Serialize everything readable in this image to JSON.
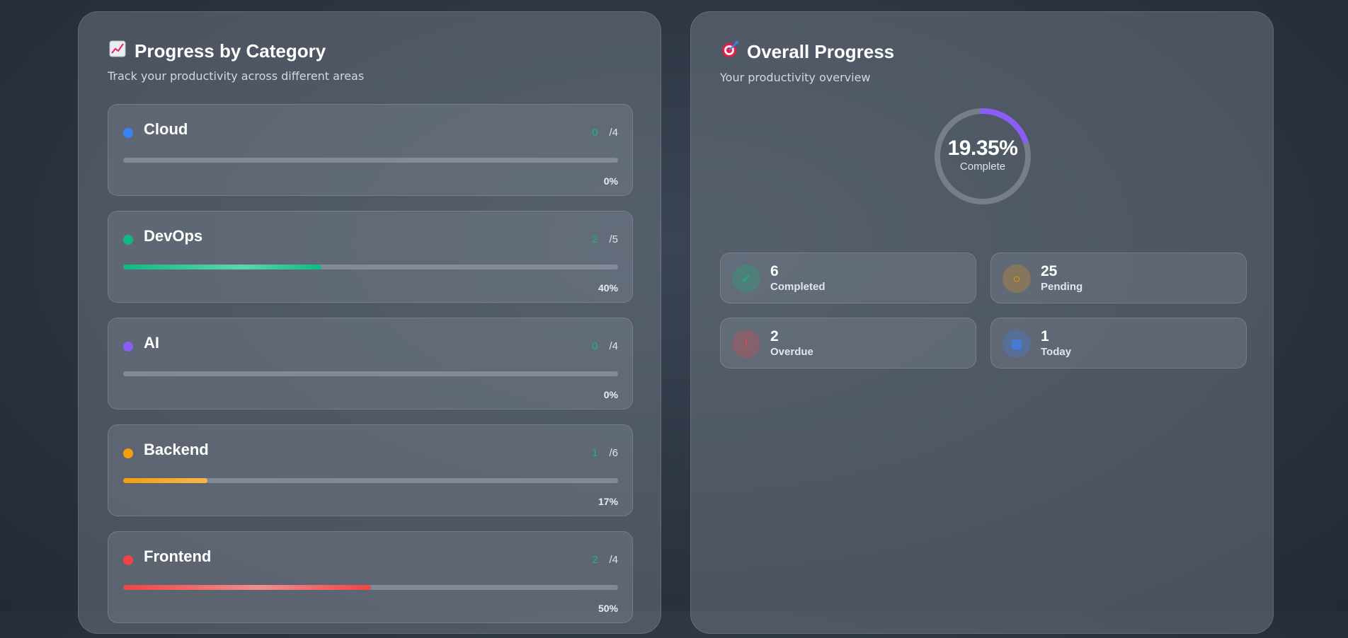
{
  "categories_panel": {
    "icon": "chart-increasing-icon",
    "title": "Progress by Category",
    "subtitle": "Track your productivity across different areas",
    "items": [
      {
        "name": "Cloud",
        "done": "0",
        "total": "/4",
        "percent_label": "0%",
        "progress": 0,
        "color": "#3b82f6",
        "fill": "#3b82f6"
      },
      {
        "name": "DevOps",
        "done": "2",
        "total": "/5",
        "percent_label": "40%",
        "progress": 0.4,
        "color": "#10b981",
        "fill": "linear-gradient(90deg,#10b981,#5ed6ad 60%,#10b981)"
      },
      {
        "name": "AI",
        "done": "0",
        "total": "/4",
        "percent_label": "0%",
        "progress": 0,
        "color": "#8b5cf6",
        "fill": "#8b5cf6"
      },
      {
        "name": "Backend",
        "done": "1",
        "total": "/6",
        "percent_label": "17%",
        "progress": 0.17,
        "color": "#f59e0b",
        "fill": "linear-gradient(90deg,#f59e0b,#f7b84a)"
      },
      {
        "name": "Frontend",
        "done": "2",
        "total": "/4",
        "percent_label": "50%",
        "progress": 0.5,
        "color": "#ef4444",
        "fill": "linear-gradient(90deg,#ef4444,#f08f8f 55%,#ef4444)"
      }
    ]
  },
  "overall_panel": {
    "icon": "direct-hit-target-icon",
    "title": "Overall Progress",
    "subtitle": "Your productivity overview",
    "ring": {
      "percent_label": "19.35%",
      "label": "Complete",
      "progress": 0.1935,
      "color": "#8b5cf6"
    },
    "stats": [
      {
        "value": "6",
        "label": "Completed",
        "icon": "check-icon",
        "glyph": "✓",
        "color": "#10b981"
      },
      {
        "value": "25",
        "label": "Pending",
        "icon": "circle-icon",
        "glyph": "○",
        "color": "#f59e0b"
      },
      {
        "value": "2",
        "label": "Overdue",
        "icon": "exclamation-icon",
        "glyph": "!",
        "color": "#ef4444"
      },
      {
        "value": "1",
        "label": "Today",
        "icon": "calendar-icon",
        "glyph": "▦",
        "color": "#3b82f6"
      }
    ]
  }
}
